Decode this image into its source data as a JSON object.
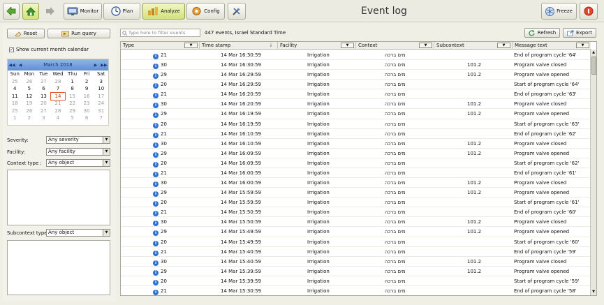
{
  "toolbar": {
    "title": "Event log",
    "monitor": "Monitor",
    "plan": "Plan",
    "analyze": "Analyze",
    "config": "Config",
    "freeze": "Freeze"
  },
  "left": {
    "reset": "Reset",
    "run_query": "Run query",
    "show_month": "Show current month calendar",
    "calendar": {
      "month_label": "March 2018",
      "weekdays": [
        "Sun",
        "Mon",
        "Tue",
        "Wed",
        "Thu",
        "Fri",
        "Sat"
      ],
      "weeks": [
        [
          "25",
          "26",
          "27",
          "28",
          "1",
          "2",
          "3"
        ],
        [
          "4",
          "5",
          "6",
          "7",
          "8",
          "9",
          "10"
        ],
        [
          "11",
          "12",
          "13",
          "14",
          "15",
          "16",
          "17"
        ],
        [
          "18",
          "19",
          "20",
          "21",
          "22",
          "23",
          "24"
        ],
        [
          "25",
          "26",
          "27",
          "28",
          "29",
          "30",
          "31"
        ],
        [
          "1",
          "2",
          "3",
          "4",
          "5",
          "6",
          "7"
        ]
      ],
      "today": "14"
    },
    "severity_label": "Severity:",
    "severity_value": "Any severity",
    "facility_label": "Facility:",
    "facility_value": "Any facility",
    "context_label": "Context type :",
    "context_value": "Any object",
    "subcontext_label": "Subcontext type :",
    "subcontext_value": "Any object"
  },
  "main": {
    "filter_placeholder": "Type here to filter events",
    "count_text": "447 events, Israel Standard Time",
    "refresh": "Refresh",
    "export": "Export",
    "columns": [
      "Type",
      "Time stamp",
      "Facility",
      "Context",
      "Subcontext",
      "Message text"
    ],
    "rows": [
      [
        "21",
        "14 Mar 16:30:59",
        "Irrigation",
        "מים ברכה",
        "",
        "End of program cycle '64'"
      ],
      [
        "30",
        "14 Mar 16:30:59",
        "Irrigation",
        "מים ברכה",
        "101.2",
        "Program valve closed"
      ],
      [
        "29",
        "14 Mar 16:29:59",
        "Irrigation",
        "מים ברכה",
        "101.2",
        "Program valve opened"
      ],
      [
        "20",
        "14 Mar 16:29:59",
        "Irrigation",
        "מים ברכה",
        "",
        "Start of program cycle '64'"
      ],
      [
        "21",
        "14 Mar 16:20:59",
        "Irrigation",
        "מים ברכה",
        "",
        "End of program cycle '63'"
      ],
      [
        "30",
        "14 Mar 16:20:59",
        "Irrigation",
        "מים ברכה",
        "101.2",
        "Program valve closed"
      ],
      [
        "29",
        "14 Mar 16:19:59",
        "Irrigation",
        "מים ברכה",
        "101.2",
        "Program valve opened"
      ],
      [
        "20",
        "14 Mar 16:19:59",
        "Irrigation",
        "מים ברכה",
        "",
        "Start of program cycle '63'"
      ],
      [
        "21",
        "14 Mar 16:10:59",
        "Irrigation",
        "מים ברכה",
        "",
        "End of program cycle '62'"
      ],
      [
        "30",
        "14 Mar 16:10:59",
        "Irrigation",
        "מים ברכה",
        "101.2",
        "Program valve closed"
      ],
      [
        "29",
        "14 Mar 16:09:59",
        "Irrigation",
        "מים ברכה",
        "101.2",
        "Program valve opened"
      ],
      [
        "20",
        "14 Mar 16:09:59",
        "Irrigation",
        "מים ברכה",
        "",
        "Start of program cycle '62'"
      ],
      [
        "21",
        "14 Mar 16:00:59",
        "Irrigation",
        "מים ברכה",
        "",
        "End of program cycle '61'"
      ],
      [
        "30",
        "14 Mar 16:00:59",
        "Irrigation",
        "מים ברכה",
        "101.2",
        "Program valve closed"
      ],
      [
        "29",
        "14 Mar 15:59:59",
        "Irrigation",
        "מים ברכה",
        "101.2",
        "Program valve opened"
      ],
      [
        "20",
        "14 Mar 15:59:59",
        "Irrigation",
        "מים ברכה",
        "",
        "Start of program cycle '61'"
      ],
      [
        "21",
        "14 Mar 15:50:59",
        "Irrigation",
        "מים ברכה",
        "",
        "End of program cycle '60'"
      ],
      [
        "30",
        "14 Mar 15:50:59",
        "Irrigation",
        "מים ברכה",
        "101.2",
        "Program valve closed"
      ],
      [
        "29",
        "14 Mar 15:49:59",
        "Irrigation",
        "מים ברכה",
        "101.2",
        "Program valve opened"
      ],
      [
        "20",
        "14 Mar 15:49:59",
        "Irrigation",
        "מים ברכה",
        "",
        "Start of program cycle '60'"
      ],
      [
        "21",
        "14 Mar 15:40:59",
        "Irrigation",
        "מים ברכה",
        "",
        "End of program cycle '59'"
      ],
      [
        "30",
        "14 Mar 15:40:59",
        "Irrigation",
        "מים ברכה",
        "101.2",
        "Program valve closed"
      ],
      [
        "29",
        "14 Mar 15:39:59",
        "Irrigation",
        "מים ברכה",
        "101.2",
        "Program valve opened"
      ],
      [
        "20",
        "14 Mar 15:39:59",
        "Irrigation",
        "מים ברכה",
        "",
        "Start of program cycle '59'"
      ],
      [
        "21",
        "14 Mar 15:30:59",
        "Irrigation",
        "מים ברכה",
        "",
        "End of program cycle '58'"
      ]
    ]
  }
}
